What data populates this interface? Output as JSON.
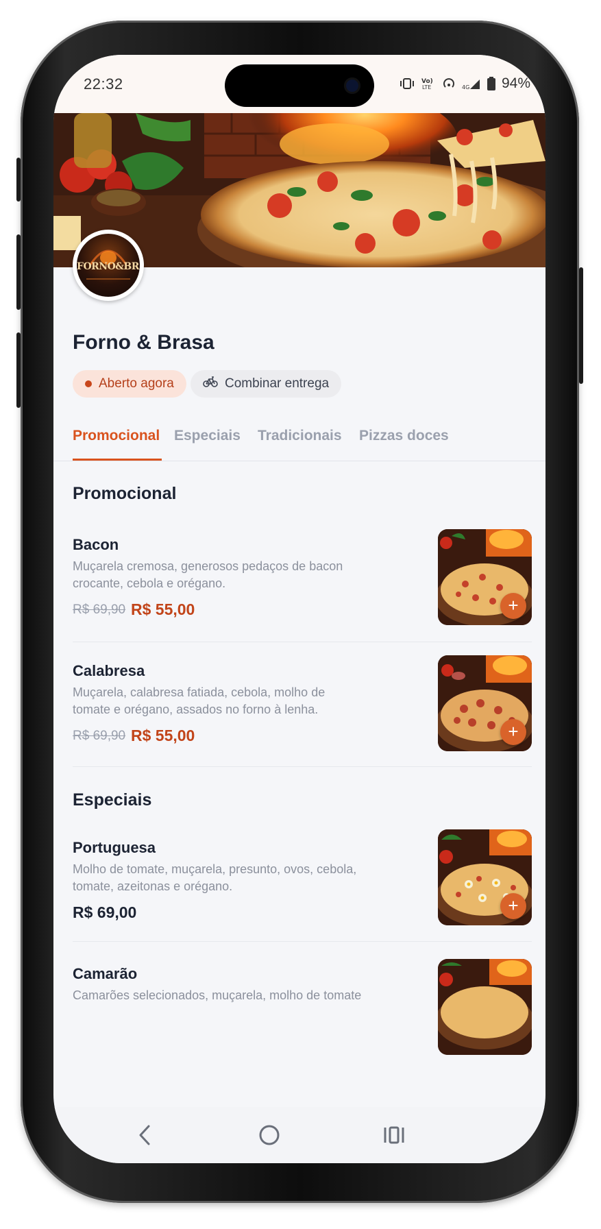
{
  "status_bar": {
    "time": "22:32",
    "battery": "94%",
    "icons": [
      "vibrate-icon",
      "volte-icon",
      "hotspot-icon",
      "signal-4g-icon",
      "battery-icon"
    ]
  },
  "restaurant": {
    "logo_text": "FORNO&BRASA",
    "name": "Forno & Brasa",
    "status_chip": "Aberto agora",
    "delivery_chip": "Combinar entrega"
  },
  "tabs": [
    {
      "label": "Promocional",
      "active": true
    },
    {
      "label": "Especiais",
      "active": false
    },
    {
      "label": "Tradicionais",
      "active": false
    },
    {
      "label": "Pizzas doces",
      "active": false
    }
  ],
  "sections": [
    {
      "title": "Promocional",
      "items": [
        {
          "name": "Bacon",
          "description": "Muçarela cremosa, generosos pedaços de bacon crocante, cebola e orégano.",
          "old_price": "R$ 69,90",
          "price": "R$ 55,00"
        },
        {
          "name": "Calabresa",
          "description": "Muçarela, calabresa fatiada, cebola, molho de tomate e orégano, assados no forno à lenha.",
          "old_price": "R$ 69,90",
          "price": "R$ 55,00"
        }
      ]
    },
    {
      "title": "Especiais",
      "items": [
        {
          "name": "Portuguesa",
          "description": "Molho de tomate, muçarela, presunto, ovos, cebola, tomate, azeitonas e orégano.",
          "price": "R$ 69,00"
        },
        {
          "name": "Camarão",
          "description": "Camarões selecionados, muçarela, molho de tomate"
        }
      ]
    }
  ],
  "add_label": "+",
  "colors": {
    "accent": "#d9531e",
    "price": "#c2451a",
    "text": "#1c2333",
    "muted": "#8b909c"
  }
}
